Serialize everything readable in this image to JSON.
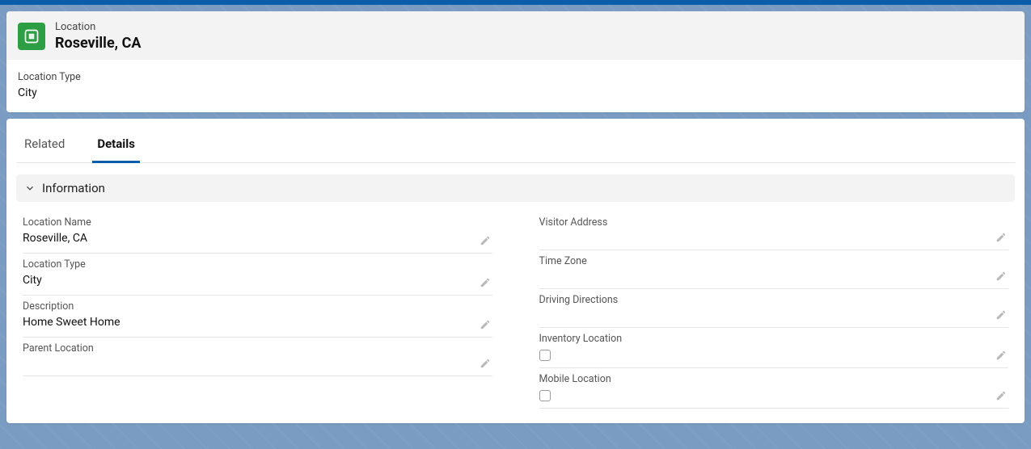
{
  "header": {
    "object_label": "Location",
    "name": "Roseville, CA",
    "highlight_field_label": "Location Type",
    "highlight_field_value": "City"
  },
  "tabs": {
    "related": "Related",
    "details": "Details"
  },
  "section": {
    "information": "Information"
  },
  "left": {
    "location_name": {
      "label": "Location Name",
      "value": "Roseville, CA"
    },
    "location_type": {
      "label": "Location Type",
      "value": "City"
    },
    "description": {
      "label": "Description",
      "value": "Home Sweet Home"
    },
    "parent": {
      "label": "Parent Location",
      "value": ""
    }
  },
  "right": {
    "visitor_address": {
      "label": "Visitor Address",
      "value": ""
    },
    "time_zone": {
      "label": "Time Zone",
      "value": ""
    },
    "driving_directions": {
      "label": "Driving Directions",
      "value": ""
    },
    "inventory_location": {
      "label": "Inventory Location",
      "checked": false
    },
    "mobile_location": {
      "label": "Mobile Location",
      "checked": false
    }
  }
}
